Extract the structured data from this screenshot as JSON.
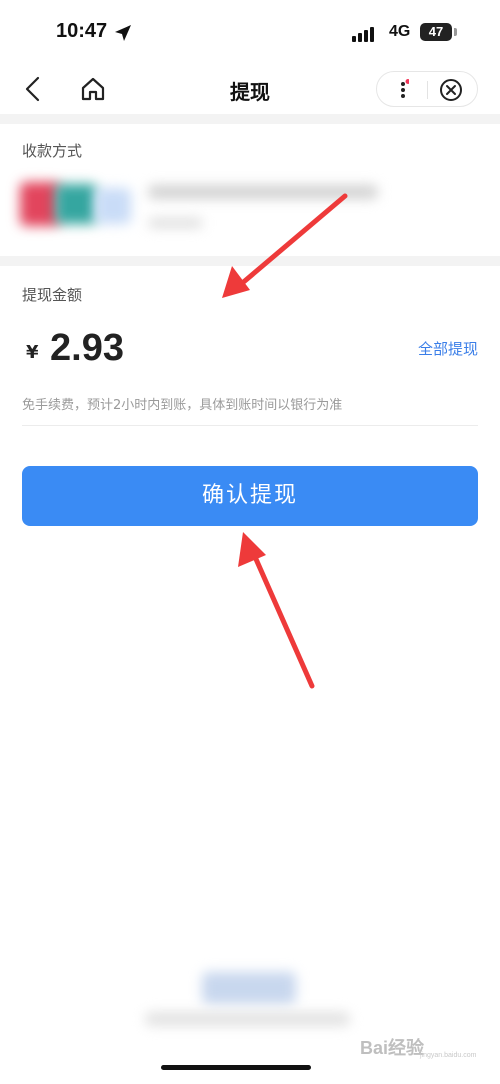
{
  "status_bar": {
    "time": "10:47",
    "network": "4G",
    "battery": "47"
  },
  "nav": {
    "title": "提现"
  },
  "payment_method": {
    "label": "收款方式"
  },
  "amount_section": {
    "label": "提现金额",
    "currency": "¥",
    "amount": "2.93",
    "withdraw_all": "全部提现",
    "fee_note": "免手续费，预计2小时内到账，具体到账时间以银行为准"
  },
  "confirm_button": {
    "label": "确认提现"
  },
  "watermark": {
    "text": "Bai经验",
    "sub": "jingyan.baidu.com"
  },
  "colors": {
    "accent": "#3a8bf4",
    "link": "#3a7ee8",
    "annotation_arrow": "#ee3a3a"
  }
}
